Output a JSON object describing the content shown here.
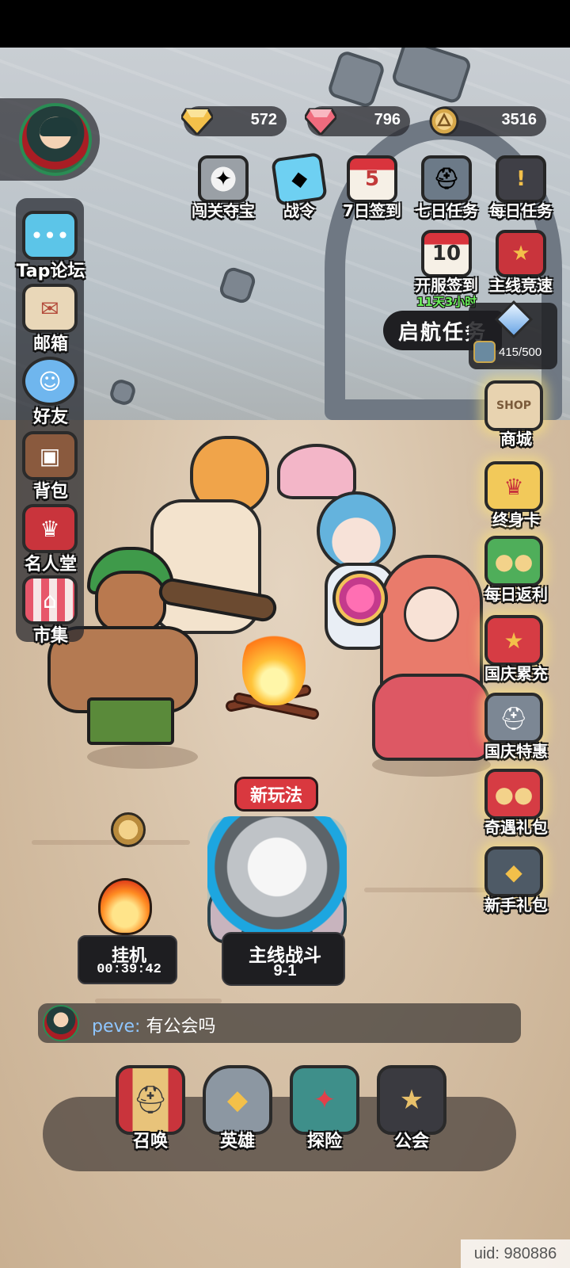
{
  "currency": {
    "gold_gem": "572",
    "red_gem": "796",
    "coin": "3516"
  },
  "sidebar": {
    "items": [
      {
        "label": "Tap论坛",
        "icon": "chat-bubble-icon"
      },
      {
        "label": "邮箱",
        "icon": "mail-icon"
      },
      {
        "label": "好友",
        "icon": "friends-icon"
      },
      {
        "label": "背包",
        "icon": "backpack-icon"
      },
      {
        "label": "名人堂",
        "icon": "hall-of-fame-icon"
      },
      {
        "label": "市集",
        "icon": "market-icon"
      }
    ]
  },
  "top_events": {
    "items": [
      {
        "label": "闯关夺宝",
        "icon": "wolf-emblem-icon"
      },
      {
        "label": "战令",
        "icon": "battle-pass-icon"
      },
      {
        "label": "7日签到",
        "icon": "calendar-icon",
        "badge": "5"
      },
      {
        "label": "七日任务",
        "icon": "helmet-icon"
      },
      {
        "label": "每日任务",
        "icon": "task-book-icon"
      }
    ],
    "row2": [
      {
        "label": "开服签到",
        "sub": "11天3小时",
        "icon": "calendar-icon",
        "badge": "10"
      },
      {
        "label": "主线竞速",
        "icon": "star-shield-icon"
      }
    ]
  },
  "quest": {
    "title": "启航任务",
    "progress": "415/500"
  },
  "right_column": {
    "items": [
      {
        "label": "商城",
        "icon": "shop-bag-icon",
        "tag": "SHOP"
      },
      {
        "label": "终身卡",
        "icon": "crown-icon"
      },
      {
        "label": "每日返利",
        "icon": "gift-box-icon"
      },
      {
        "label": "国庆累充",
        "icon": "star-chest-icon"
      },
      {
        "label": "国庆特惠",
        "icon": "helmet-chest-icon"
      },
      {
        "label": "奇遇礼包",
        "icon": "gift-box-icon"
      },
      {
        "label": "新手礼包",
        "icon": "gold-chest-icon"
      }
    ]
  },
  "idle": {
    "label": "挂机",
    "timer": "00:39:42"
  },
  "battle": {
    "tag": "新玩法",
    "label": "主线战斗",
    "stage": "9-1"
  },
  "chat": {
    "name": "peve:",
    "message": "有公会吗"
  },
  "nav": {
    "items": [
      {
        "label": "召唤",
        "icon": "summon-book-icon"
      },
      {
        "label": "英雄",
        "icon": "hero-helmet-icon"
      },
      {
        "label": "探险",
        "icon": "compass-icon"
      },
      {
        "label": "公会",
        "icon": "guild-shield-icon"
      }
    ]
  },
  "uid": "uid: 980886"
}
